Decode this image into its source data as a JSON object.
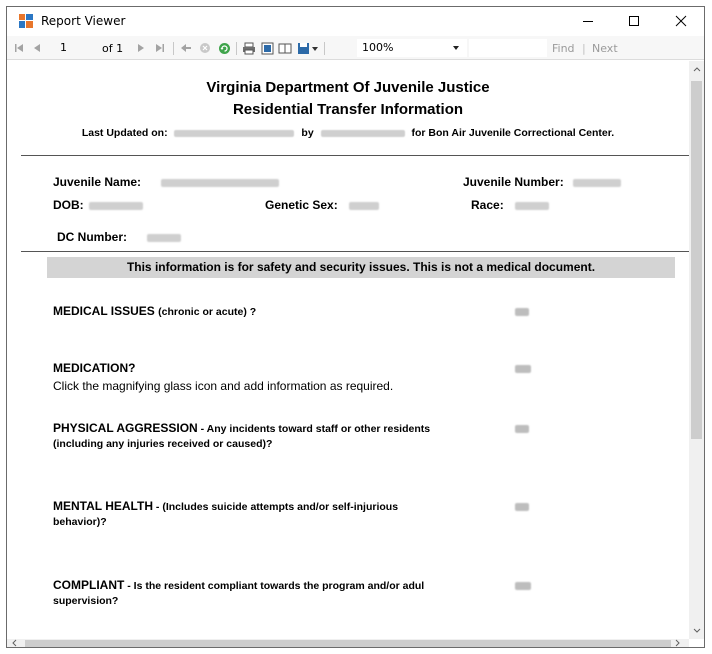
{
  "window": {
    "title": "Report Viewer"
  },
  "toolbar": {
    "page_current": "1",
    "page_of": "of 1",
    "zoom": "100%",
    "find": "Find",
    "separator": "|",
    "next": "Next"
  },
  "report": {
    "heading1": "Virginia Department Of Juvenile Justice",
    "heading2": "Residential Transfer Information",
    "last_updated_label": "Last Updated on:",
    "by_label": "by",
    "facility_text": "for Bon Air Juvenile Correctional Center.",
    "fields": {
      "juvenile_name_label": "Juvenile Name:",
      "juvenile_number_label": "Juvenile Number:",
      "dob_label": "DOB:",
      "genetic_sex_label": "Genetic Sex:",
      "race_label": "Race:",
      "dc_number_label": "DC Number:"
    },
    "banner": "This information is for safety and security issues.  This is not a medical document.",
    "questions": [
      {
        "title": "MEDICAL ISSUES",
        "detail": "(chronic or acute) ?",
        "note": ""
      },
      {
        "title": "MEDICATION?",
        "detail": "",
        "note": "Click the magnifying glass icon and add information as required."
      },
      {
        "title": "PHYSICAL AGGRESSION",
        "detail": " - Any incidents toward staff or other residents",
        "detail2": "(including any injuries received or caused)?",
        "note": ""
      },
      {
        "title": "MENTAL HEALTH",
        "detail": " -  (Includes suicide attempts and/or self-injurious",
        "detail2": "behavior)?",
        "note": ""
      },
      {
        "title": "COMPLIANT",
        "detail": " - Is the resident compliant towards the program and/or adul",
        "detail2": "supervision?",
        "note": ""
      }
    ]
  }
}
